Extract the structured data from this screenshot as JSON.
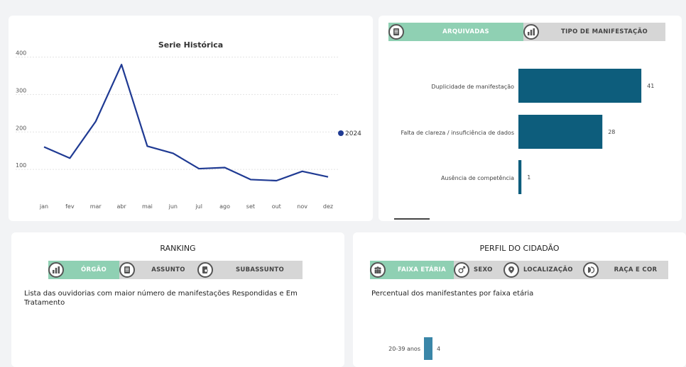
{
  "serie": {
    "title": "Serie Histórica",
    "legend": "2024",
    "yticks": [
      "400",
      "300",
      "200",
      "100"
    ],
    "chart_data": {
      "type": "line",
      "title": "Serie Histórica",
      "categories": [
        "jan",
        "fev",
        "mar",
        "abr",
        "mai",
        "jun",
        "jul",
        "ago",
        "set",
        "out",
        "nov",
        "dez"
      ],
      "series": [
        {
          "name": "2024",
          "values": [
            160,
            130,
            228,
            380,
            162,
            143,
            102,
            105,
            73,
            70,
            95,
            80
          ],
          "color": "#1f3a93"
        }
      ],
      "ylim": [
        0,
        420
      ],
      "grid": true,
      "legend_position": "right"
    }
  },
  "tipo": {
    "tabs": [
      {
        "label": "ARQUIVADAS",
        "icon": "document-icon",
        "active": true
      },
      {
        "label": "TIPO DE MANIFESTAÇÃO",
        "icon": "bar-chart-icon",
        "active": false
      }
    ],
    "chart_data": {
      "type": "bar",
      "orientation": "horizontal",
      "categories": [
        "Duplicidade de manifestação",
        "Falta de clareza / insuficiência de dados",
        "Ausência de competência"
      ],
      "values": [
        41,
        28,
        1
      ],
      "color": "#0d5d7c"
    }
  },
  "ranking": {
    "title": "RANKING",
    "tabs": [
      {
        "label": "ÓRGÃO",
        "icon": "bar-chart-icon",
        "active": true
      },
      {
        "label": "ASSUNTO",
        "icon": "document-icon",
        "active": false
      },
      {
        "label": "SUBASSUNTO",
        "icon": "search-document-icon",
        "active": false
      }
    ],
    "description": "Lista das ouvidorias com maior número de manifestações Respondidas e Em Tratamento"
  },
  "perfil": {
    "title": "PERFIL DO CIDADÃO",
    "tabs": [
      {
        "label": "FAIXA ETÁRIA",
        "icon": "people-icon",
        "active": true
      },
      {
        "label": "SEXO",
        "icon": "gender-icon",
        "active": false
      },
      {
        "label": "LOCALIZAÇÃO",
        "icon": "location-pin-icon",
        "active": false
      },
      {
        "label": "RAÇA E COR",
        "icon": "faces-icon",
        "active": false
      }
    ],
    "description": "Percentual dos manifestantes por faixa etária",
    "chart_data": {
      "type": "bar",
      "orientation": "horizontal",
      "categories": [
        "20-39 anos"
      ],
      "values": [
        4
      ],
      "color": "#3a86a8"
    }
  }
}
